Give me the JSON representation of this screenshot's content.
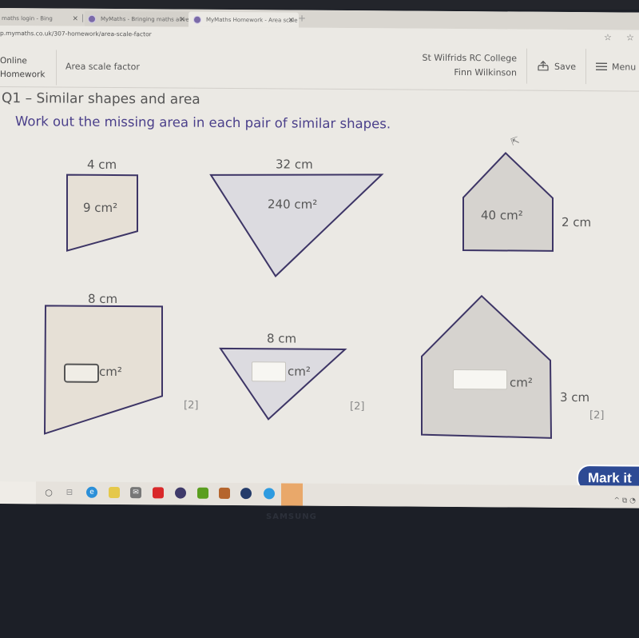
{
  "browser": {
    "tabs": [
      {
        "label": "maths login - Bing",
        "active": false
      },
      {
        "label": "MyMaths - Bringing maths alive",
        "active": false
      },
      {
        "label": "MyMaths Homework - Area scale",
        "active": true
      }
    ],
    "new_tab_icon": "+",
    "close_icon": "×",
    "url": "p.mymaths.co.uk/307-homework/area-scale-factor",
    "star_icon": "☆"
  },
  "header": {
    "brand_line1": "Online",
    "brand_line2": "Homework",
    "breadcrumb": "Area scale factor",
    "school": "St Wilfrids RC College",
    "student": "Finn Wilkinson",
    "save_label": "Save",
    "menu_label": "Menu"
  },
  "question": {
    "title": "Q1 – Similar shapes and area",
    "instruction": "Work out the missing area in each pair of similar shapes.",
    "pairs": [
      {
        "shape": "quadrilateral",
        "small": {
          "length": "4 cm",
          "area": "9 cm²"
        },
        "large": {
          "length": "8 cm",
          "area_input": "",
          "unit": "cm²"
        },
        "marks": "[2]"
      },
      {
        "shape": "triangle",
        "small": {
          "length": "8 cm",
          "area_input": "",
          "unit": "cm²"
        },
        "large": {
          "length": "32 cm",
          "area": "240 cm²"
        },
        "marks": "[2]"
      },
      {
        "shape": "pentagon",
        "small": {
          "length": "2 cm",
          "area": "40 cm²"
        },
        "large": {
          "length": "3 cm",
          "area_input": "",
          "unit": "cm²"
        },
        "marks": "[2]"
      }
    ],
    "mark_button": "Mark it"
  },
  "colors": {
    "accent": "#2d4a94",
    "instruction_text": "#4a3f8a",
    "shape_outline": "#3d3566",
    "quad_fill": "#e6e0d6",
    "tri_fill": "#dcdbe0",
    "pent_fill": "#d6d3cf"
  },
  "taskbar": {
    "icons": [
      "search-icon",
      "task-view-icon",
      "edge-icon",
      "file-explorer-icon",
      "mail-icon",
      "game-app-icon",
      "game-launcher-icon",
      "nvidia-icon",
      "game-icon",
      "steam-icon",
      "app-icon",
      "discord-icon"
    ],
    "tray_icons": "^ ⧉ ◔"
  },
  "monitor": {
    "brand": "SAMSUNG"
  }
}
